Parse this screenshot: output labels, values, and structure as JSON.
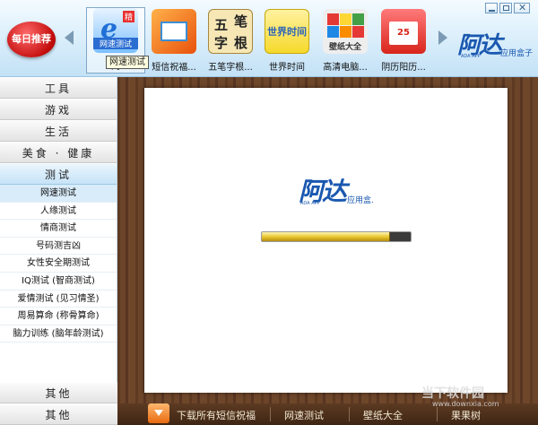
{
  "header": {
    "daily_badge": "每日推荐",
    "apps": [
      {
        "label": "网速测试",
        "icon": "speed-test-icon",
        "icon_tag": "网速测试",
        "icon_corner": "精"
      },
      {
        "label": "短信祝福...",
        "icon": "sms-icon"
      },
      {
        "label": "五笔字根...",
        "icon": "wubi-icon",
        "glyphs": [
          "五",
          "笔",
          "字",
          "根"
        ]
      },
      {
        "label": "世界时间",
        "icon": "world-time-icon",
        "icon_text": "世界时间"
      },
      {
        "label": "高清电脑...",
        "icon": "wallpaper-icon",
        "icon_text": "壁纸大全"
      },
      {
        "label": "阴历阳历...",
        "icon": "calendar-icon",
        "icon_text": "25"
      }
    ],
    "selected_app_visible_label": "网",
    "tooltip": "网速测试",
    "brand": {
      "main": "阿达",
      "sub": "应用盒子",
      "tiny": "ADA APP"
    }
  },
  "sidebar": {
    "categories": [
      "工具",
      "游戏",
      "生活",
      "美食 · 健康",
      "测试"
    ],
    "active_category": "测试",
    "subitems": [
      "网速测试",
      "人缘测试",
      "情商测试",
      "号码测吉凶",
      "女性安全期测试",
      "IQ测试 (智商测试)",
      "爱情测试 (见习情圣)",
      "周易算命 (称骨算命)",
      "脑力训练 (脑年龄测试)"
    ],
    "selected_subitem": "网速测试",
    "bottom": [
      "其他",
      "其他"
    ]
  },
  "main": {
    "logo": {
      "main": "阿达",
      "sub": "应用盒.",
      "tiny": "ADA APP"
    },
    "progress": 0.86
  },
  "footer": {
    "links": [
      "下载所有短信祝福",
      "网速测试",
      "壁纸大全",
      "果果树"
    ]
  },
  "watermark": {
    "main": "当下软件园",
    "sub": "www.downxia.com"
  },
  "colors": {
    "accent_blue": "#1a58b0",
    "wood": "#6b4429",
    "sidebar_active": "#c6e3f7"
  }
}
